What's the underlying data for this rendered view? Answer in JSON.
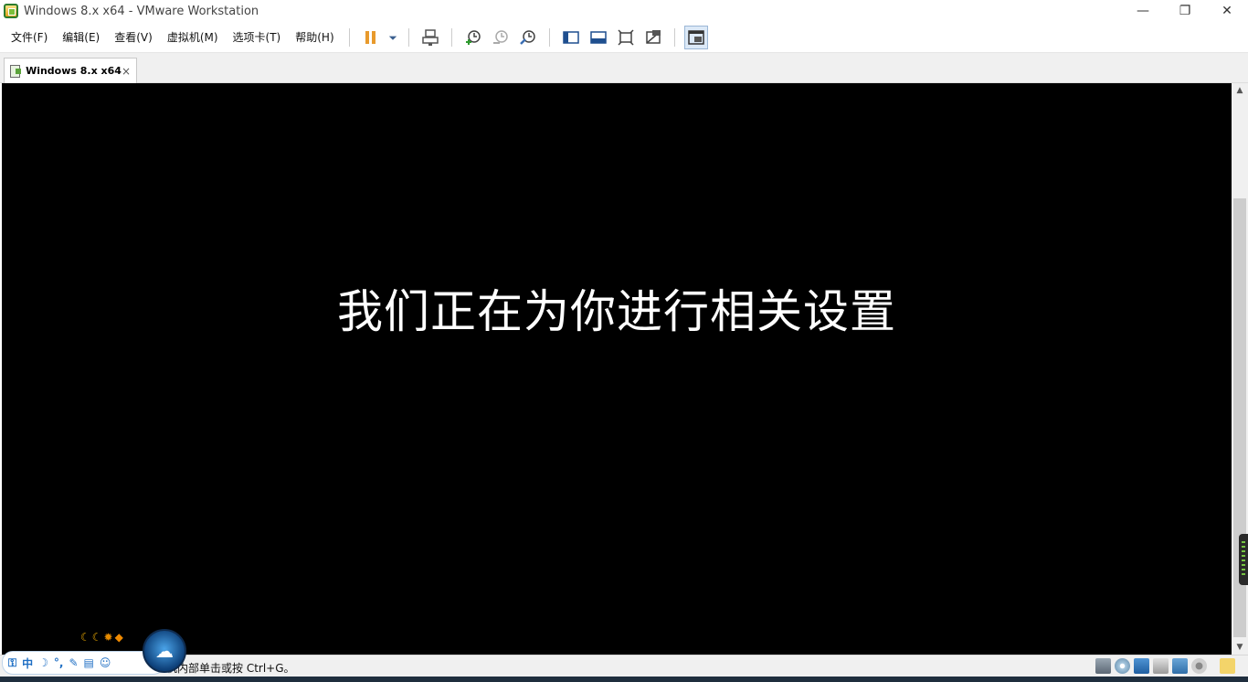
{
  "window": {
    "title": "Windows 8.x x64 - VMware Workstation",
    "minimize": "—",
    "restore": "❐",
    "close": "✕"
  },
  "menu": {
    "items": [
      "文件(F)",
      "编辑(E)",
      "查看(V)",
      "虚拟机(M)",
      "选项卡(T)",
      "帮助(H)"
    ]
  },
  "toolbar": {
    "buttons": [
      "pause-icon",
      "dropdown-arrow-icon",
      "send-ctrl-alt-del-icon",
      "snapshot-take-icon",
      "snapshot-revert-icon",
      "snapshot-manager-icon",
      "show-library-icon",
      "thumbnail-bar-icon",
      "full-screen-icon",
      "unity-icon",
      "console-view-icon"
    ]
  },
  "tabs": [
    {
      "label": "Windows 8.x x64",
      "close": "×"
    }
  ],
  "vm_screen": {
    "message": "我们正在为你进行相关设置"
  },
  "status_bar": {
    "text": "机内部单击或按 Ctrl+G。",
    "device_icons": [
      "hard-disk-icon",
      "cd-dvd-icon",
      "network-icon",
      "printer-icon",
      "sound-icon",
      "usb-icon",
      "message-icon"
    ]
  },
  "ime": {
    "lang": "中",
    "logo": "☁"
  },
  "colors": {
    "vm_background": "#000000",
    "accent": "#1f6fc4"
  }
}
